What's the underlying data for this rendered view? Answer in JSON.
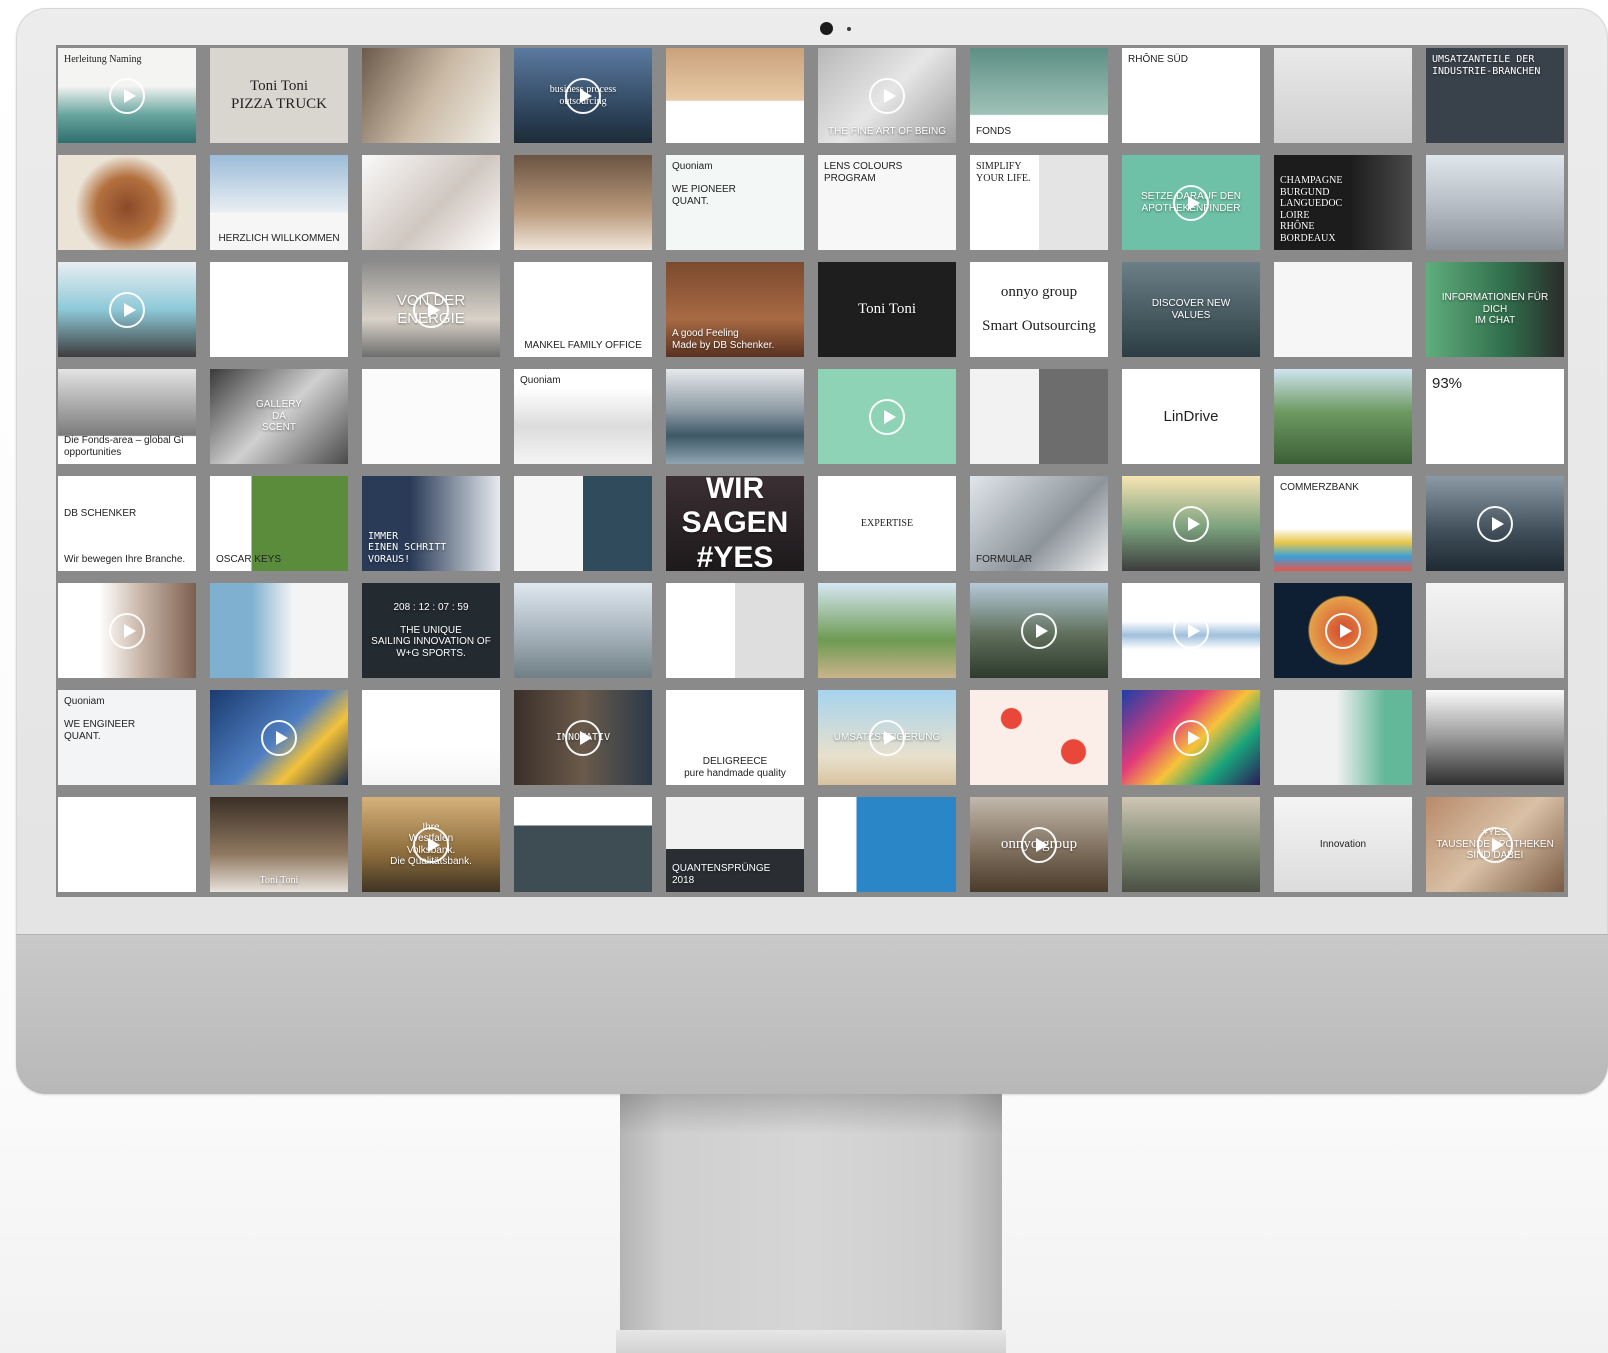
{
  "tiles": [
    {
      "label": "Herleitung Naming",
      "bg": "linear-gradient(#f4f4f2 0%, #f4f4f2 40%, #6aa6a0 70%, #2e6e6c 100%)",
      "style": "tl serif",
      "play": true
    },
    {
      "label": "Toni Toni\nPIZZA TRUCK",
      "bg": "#d9d6d0",
      "style": "serif big",
      "play": false
    },
    {
      "label": "",
      "bg": "linear-gradient(120deg,#6b5a4a,#c9b9a4 50%,#f2efe8)",
      "style": "",
      "play": false
    },
    {
      "label": "business process\noutsourcing",
      "bg": "linear-gradient(#5b7aa0,#2c4258 70%,#1d2c38)",
      "style": "serif light",
      "play": true
    },
    {
      "label": "",
      "bg": "linear-gradient(#c9a27a 0%,#e8c9a8 55%,#ffffff 56%)",
      "style": "",
      "play": false
    },
    {
      "label": "THE FINE ART OF BEING",
      "bg": "linear-gradient(135deg,#b8b8b8,#e6e6e6 50%,#9c9c9c)",
      "style": "bc light",
      "play": true
    },
    {
      "label": "FONDS",
      "bg": "linear-gradient(#5e8f84,#9fc2b8 70%,#ffffff 71%)",
      "style": "bl",
      "play": false
    },
    {
      "label": "RHÔNE SÜD",
      "bg": "#ffffff",
      "style": "tl",
      "play": false
    },
    {
      "label": "",
      "bg": "linear-gradient(#e9e9e9,#cfcfcf)",
      "style": "",
      "play": false
    },
    {
      "label": "UMSATZANTEILE DER\nINDUSTRIE-BRANCHEN",
      "bg": "#39414a",
      "style": "tl mono light",
      "play": false
    },
    {
      "label": "",
      "bg": "radial-gradient(circle at 50% 55%,#8a4a2a 0,#b3703e 35%,#eae3d6 60%)",
      "style": "",
      "play": false
    },
    {
      "label": "HERZLICH WILLKOMMEN",
      "bg": "linear-gradient(#9bbcd8,#e9eef2 60%,#f6f6f6 61%)",
      "style": "bc",
      "play": false
    },
    {
      "label": "",
      "bg": "linear-gradient(135deg,#fafafa,#cfc6bf 55%,#ffffff)",
      "style": "",
      "play": false
    },
    {
      "label": "",
      "bg": "linear-gradient(#6a5442,#b99a7c 60%,#f0e6da)",
      "style": "",
      "play": false
    },
    {
      "label": "Quoniam\n\nWE PIONEER\nQUANT.",
      "bg": "#f3f7f6",
      "style": "tl",
      "play": false
    },
    {
      "label": "LENS COLOURS\nPROGRAM",
      "bg": "#f7f7f7",
      "style": "tl",
      "play": false
    },
    {
      "label": "SIMPLIFY\nYOUR LIFE.",
      "bg": "linear-gradient(90deg,#ffffff 50%,#e4e4e4 50%)",
      "style": "tl serif",
      "play": false
    },
    {
      "label": "SETZE DARAUF DEN\nAPOTHEKENFINDER",
      "bg": "#6ec1a6",
      "style": "light",
      "play": true
    },
    {
      "label": "CHAMPAGNE\nBURGUND\nLANGUEDOC\nLOIRE\nRHÔNE\nBORDEAUX",
      "bg": "linear-gradient(90deg,#1c1c1c 55%,#4a4a4a)",
      "style": "bl serif light",
      "play": false
    },
    {
      "label": "",
      "bg": "linear-gradient(#dfe6ec,#b8bfc6 50%,#8d939a)",
      "style": "",
      "play": false
    },
    {
      "label": "",
      "bg": "linear-gradient(#e8eef2,#8ec9d8 50%,#3d3d3d)",
      "style": "",
      "play": true
    },
    {
      "label": "",
      "bg": "#ffffff",
      "style": "",
      "play": false
    },
    {
      "label": "VON DER\nENERGIE",
      "bg": "linear-gradient(#8c8c8c,#d8d2c8 60%,#6e6e6e)",
      "style": "light big",
      "play": true
    },
    {
      "label": "MANKEL FAMILY OFFICE",
      "bg": "#ffffff",
      "style": "bc",
      "play": false
    },
    {
      "label": "A good Feeling\nMade by DB Schenker.",
      "bg": "linear-gradient(#7b4a2e,#a86a44 60%,#5a3220)",
      "style": "bl light",
      "play": false
    },
    {
      "label": "Toni Toni",
      "bg": "#1e1e1e",
      "style": "serif big light",
      "play": false
    },
    {
      "label": "onnyo group\n\nSmart Outsourcing",
      "bg": "#ffffff",
      "style": "serif big",
      "play": false
    },
    {
      "label": "DISCOVER NEW\nVALUES",
      "bg": "linear-gradient(#6b7f86,#2c3e44)",
      "style": "light",
      "play": false
    },
    {
      "label": "",
      "bg": "#f6f6f6",
      "style": "",
      "play": false
    },
    {
      "label": "INFORMATIONEN FÜR DICH\nIM CHAT",
      "bg": "linear-gradient(90deg,#5fae7d,#2f6b4a 60%,#2b2b2b)",
      "style": "light",
      "play": false
    },
    {
      "label": "Die Fonds-area – global Gi opportunities",
      "bg": "linear-gradient(#e3e3e3,#7b7b7b 70%,#ffffff 71%)",
      "style": "bl",
      "play": false
    },
    {
      "label": "GALLERY\nDA\nSCENT",
      "bg": "linear-gradient(135deg,#3a3a3a,#d0d0d0 50%,#4a4a4a)",
      "style": "light",
      "play": false
    },
    {
      "label": "",
      "bg": "#fbfbfb",
      "style": "",
      "play": false
    },
    {
      "label": "Quoniam",
      "bg": "linear-gradient(#ffffff 20%,#dcdcdc 60%,#f4f4f4)",
      "style": "tl",
      "play": false
    },
    {
      "label": "",
      "bg": "linear-gradient(#e6e8ea,#8a98a2 45%,#3e5866 70%,#8fa6b2)",
      "style": "",
      "play": false
    },
    {
      "label": "",
      "bg": "#8fd3b6",
      "style": "",
      "play": true
    },
    {
      "label": "",
      "bg": "linear-gradient(90deg,#f2f2f2 50%,#6d6d6d 50%)",
      "style": "",
      "play": false
    },
    {
      "label": "LinDrive",
      "bg": "#ffffff",
      "style": "big",
      "play": false
    },
    {
      "label": "",
      "bg": "linear-gradient(#cfe4f0,#6e9a62 45%,#3b5f36)",
      "style": "",
      "play": false
    },
    {
      "label": "93%",
      "bg": "#ffffff",
      "style": "tl big",
      "play": false
    },
    {
      "label": "DB SCHENKER\n\n\n\nWir bewegen Ihre Branche.",
      "bg": "#ffffff",
      "style": "bl",
      "play": false
    },
    {
      "label": "OSCAR KEYS",
      "bg": "linear-gradient(90deg,#ffffff 30%,#5b8c3c 30%)",
      "style": "bl",
      "play": false
    },
    {
      "label": "IMMER\nEINEN SCHRITT\nVORAUS!",
      "bg": "linear-gradient(90deg,#2a3b58 35%,#e7ebef)",
      "style": "bl mono light",
      "play": false
    },
    {
      "label": "",
      "bg": "linear-gradient(90deg,#f6f6f6 50%,#2f4b5c 50%)",
      "style": "",
      "play": false
    },
    {
      "label": "WIR SAGEN\n#YES",
      "bg": "linear-gradient(#3b2f33,#1d1a1c)",
      "style": "huge light",
      "play": false
    },
    {
      "label": "EXPERTISE",
      "bg": "#ffffff",
      "style": "serif",
      "play": false
    },
    {
      "label": "FORMULAR",
      "bg": "linear-gradient(135deg,#e0e6ea,#8d959b 60%,#f2f2f2)",
      "style": "bl",
      "play": false
    },
    {
      "label": "",
      "bg": "linear-gradient(#f7e5b4,#7aa07c 55%,#3d3d3d)",
      "style": "",
      "play": true
    },
    {
      "label": "COMMERZBANK",
      "bg": "linear-gradient(#ffffff 55%,#e9c74a 70%,#3aa0d8 85%,#e8564b)",
      "style": "tl",
      "play": false
    },
    {
      "label": "",
      "bg": "linear-gradient(#8c9aa6,#3f4d58 60%,#1f2a33)",
      "style": "",
      "play": true
    },
    {
      "label": "",
      "bg": "linear-gradient(90deg,#ffffff 30%,#c9b6a8 60%,#7c5f4f)",
      "style": "",
      "play": true
    },
    {
      "label": "",
      "bg": "linear-gradient(90deg,#7fb0d0 30%,#f4f4f4 60%)",
      "style": "",
      "play": false
    },
    {
      "label": "208 : 12 : 07 : 59\n\nTHE UNIQUE\nSAILING INNOVATION OF\nW+G SPORTS.",
      "bg": "#232a30",
      "style": "light",
      "play": false
    },
    {
      "label": "",
      "bg": "linear-gradient(#dfe7ef,#a5b1ba 55%,#6f7f84)",
      "style": "",
      "play": false
    },
    {
      "label": "",
      "bg": "linear-gradient(90deg,#ffffff 50%,#dedede 50%)",
      "style": "",
      "play": false
    },
    {
      "label": "",
      "bg": "linear-gradient(#d6e8f4,#6d9a52 60%,#c9b48a)",
      "style": "",
      "play": false
    },
    {
      "label": "",
      "bg": "linear-gradient(#b5c9d8,#5e6e5a 55%,#2d3a2d)",
      "style": "",
      "play": true
    },
    {
      "label": "",
      "bg": "linear-gradient(#ffffff 40%,#9fc0dc 55%,#ffffff 70%)",
      "style": "",
      "play": true
    },
    {
      "label": "",
      "bg": "radial-gradient(circle at 50% 50%,#d6482e 0,#e4a24a 40%,#0f1f33 42%)",
      "style": "",
      "play": true
    },
    {
      "label": "",
      "bg": "linear-gradient(#f3f3f3,#dadada)",
      "style": "",
      "play": false
    },
    {
      "label": "Quoniam\n\nWE ENGINEER\nQUANT.",
      "bg": "#f2f4f5",
      "style": "tl",
      "play": false
    },
    {
      "label": "",
      "bg": "linear-gradient(135deg,#1a3b6e,#4f7fc2 50%,#f3c23a 70%,#1a2a4a)",
      "style": "",
      "play": true
    },
    {
      "label": "",
      "bg": "linear-gradient(#ffffff 60%,#f4f4f4)",
      "style": "",
      "play": false
    },
    {
      "label": "INNOVATIV",
      "bg": "linear-gradient(90deg,#3a2f2a,#6a5a4a 50%,#2a3a4a)",
      "style": "mono light",
      "play": true
    },
    {
      "label": "DELIGREECE\npure handmade quality",
      "bg": "#ffffff",
      "style": "bc",
      "play": false
    },
    {
      "label": "UMSATZSTEIGERUNG",
      "bg": "linear-gradient(#a6d4ee,#e8e0cc 70%,#d7c3a0)",
      "style": "light",
      "play": true
    },
    {
      "label": "",
      "bg": "radial-gradient(circle at 30% 30%,#e9473a 0 10px,transparent 11px),radial-gradient(circle at 75% 65%,#e9473a 0 12px,transparent 13px),#fbeee8",
      "style": "",
      "play": false
    },
    {
      "label": "",
      "bg": "linear-gradient(135deg,#1c3fa8,#e13a7a 35%,#f6c33a 55%,#1aa37a 75%,#2a1d5a)",
      "style": "",
      "play": true
    },
    {
      "label": "",
      "bg": "linear-gradient(90deg,#f1f1f1 45%,#64b89a 80%)",
      "style": "",
      "play": false
    },
    {
      "label": "",
      "bg": "linear-gradient(#fafafa,#9a9a9a 50%,#2f2f2f)",
      "style": "",
      "play": false
    },
    {
      "label": "",
      "bg": "#ffffff",
      "style": "",
      "play": false
    },
    {
      "label": "Toni Toni",
      "bg": "linear-gradient(#3a2f26,#8f7860 60%,#e8e3dc)",
      "style": "bc serif light",
      "play": false
    },
    {
      "label": "Ihre\nWestfalen\nVolksbank.\nDie Qualitätsbank.",
      "bg": "linear-gradient(#d6b27a,#8c6c3c 60%,#3f3424)",
      "style": "light",
      "play": true
    },
    {
      "label": "",
      "bg": "linear-gradient(#ffffff 30%,#3e4d54 30%)",
      "style": "",
      "play": false
    },
    {
      "label": "QUANTENSPRÜNGE\n2018",
      "bg": "linear-gradient(#f1f1f1 55%,#2a2e33 55%)",
      "style": "bl light",
      "play": false
    },
    {
      "label": "",
      "bg": "linear-gradient(90deg,#ffffff 28%,#2b86c8 28%)",
      "style": "",
      "play": false
    },
    {
      "label": "onnyo group",
      "bg": "linear-gradient(#c2b8ac,#7a6a58 60%,#4a3c2c)",
      "style": "serif light big",
      "play": true
    },
    {
      "label": "",
      "bg": "linear-gradient(#cfc6b4,#7f8a72 55%,#4a5044)",
      "style": "",
      "play": false
    },
    {
      "label": "Innovation",
      "bg": "linear-gradient(#f4f4f4,#dcdcdc)",
      "style": "",
      "play": false
    },
    {
      "label": "#YES\nTAUSENDE APOTHEKEN\nSIND DABEI",
      "bg": "linear-gradient(135deg,#b88a6a,#d9c1a6 50%,#7a5a44)",
      "style": "light",
      "play": true
    }
  ]
}
